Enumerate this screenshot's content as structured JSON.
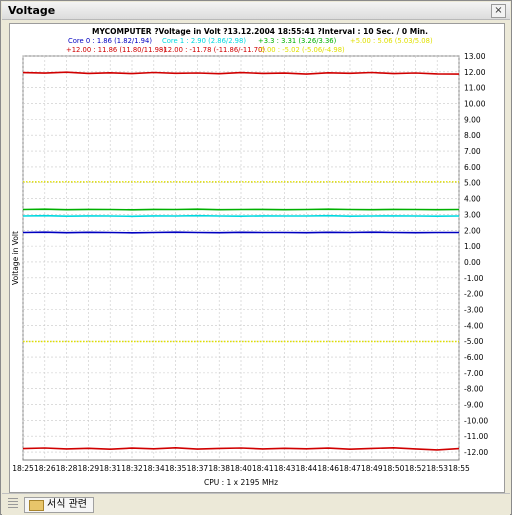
{
  "window": {
    "title": "Voltage",
    "close_glyph": "×"
  },
  "statusbar": {
    "tab_label": "서식 관련",
    "tab_icon": "folder-icon"
  },
  "colors": {
    "red": "#d00000",
    "blue": "#0000c0",
    "cyan": "#00d8e0",
    "green": "#00b000",
    "yellow": "#e0e000",
    "grid": "#c8c8c8"
  },
  "chart_data": {
    "type": "line",
    "title": "MYCOMPUTER ?Voltage in Volt ?13.12.2004 18:55:41 ?Interval : 10 Sec. / 0 Min.",
    "ylabel": "Voltage in Volt",
    "xlabel": "CPU : 1 x 2195 MHz",
    "ylim": [
      -12.5,
      13
    ],
    "y_ticks": [
      "13.00",
      "12.00",
      "11.00",
      "10.00",
      "9.00",
      "8.00",
      "7.00",
      "6.00",
      "5.00",
      "4.00",
      "3.00",
      "2.00",
      "1.00",
      "0.00",
      "-1.00",
      "-2.00",
      "-3.00",
      "-4.00",
      "-5.00",
      "-6.00",
      "-7.00",
      "-8.00",
      "-9.00",
      "-10.00",
      "-11.00",
      "-12.00"
    ],
    "x_ticks": [
      "18:25",
      "18:26",
      "18:28",
      "18:29",
      "18:31",
      "18:32",
      "18:34",
      "18:35",
      "18:37",
      "18:38",
      "18:40",
      "18:41",
      "18:43",
      "18:44",
      "18:46",
      "18:47",
      "18:49",
      "18:50",
      "18:52",
      "18:53",
      "18:55"
    ],
    "grid": true,
    "legend_position": "top",
    "legend": [
      {
        "text": "Core 0 : 1.86 (1.82/1.94)",
        "color": "#0000c0"
      },
      {
        "text": "Core 1 : 2.90 (2.86/2.98)",
        "color": "#00d8e0"
      },
      {
        "text": "+3.3 : 3.31 (3.26/3.36)",
        "color": "#00b000"
      },
      {
        "text": "+5.00 : 5.06 (5.03/5.08)",
        "color": "#e0e000"
      },
      {
        "text": "+12.00 : 11.86 (11.80/11.98)",
        "color": "#d00000"
      },
      {
        "text": "-12.00 : -11.78 (-11.86/-11.70)",
        "color": "#d00000"
      },
      {
        "text": "-5.00 : -5.02 (-5.06/-4.98)",
        "color": "#e0e000"
      }
    ],
    "series": [
      {
        "name": "Core 0",
        "color": "#0000c0",
        "values": [
          1.86,
          1.88,
          1.85,
          1.87,
          1.86,
          1.84,
          1.86,
          1.88,
          1.86,
          1.85,
          1.87,
          1.86,
          1.86,
          1.85,
          1.87,
          1.86,
          1.88,
          1.86,
          1.85,
          1.86,
          1.86
        ]
      },
      {
        "name": "Core 1",
        "color": "#00d8e0",
        "values": [
          2.9,
          2.92,
          2.89,
          2.91,
          2.9,
          2.88,
          2.91,
          2.9,
          2.92,
          2.9,
          2.89,
          2.91,
          2.9,
          2.9,
          2.92,
          2.89,
          2.9,
          2.91,
          2.9,
          2.89,
          2.9
        ]
      },
      {
        "name": "+3.3",
        "color": "#00b000",
        "values": [
          3.31,
          3.33,
          3.3,
          3.32,
          3.31,
          3.29,
          3.32,
          3.31,
          3.33,
          3.3,
          3.31,
          3.32,
          3.3,
          3.31,
          3.33,
          3.31,
          3.3,
          3.32,
          3.31,
          3.3,
          3.31
        ]
      },
      {
        "name": "+5.00",
        "color": "#e0e000",
        "values": [
          5.06,
          5.06,
          5.06,
          5.06,
          5.06,
          5.06,
          5.06,
          5.06,
          5.06,
          5.06,
          5.06,
          5.06,
          5.06,
          5.06,
          5.06,
          5.06,
          5.06,
          5.06,
          5.06,
          5.06,
          5.06
        ]
      },
      {
        "name": "+12.00",
        "color": "#d00000",
        "values": [
          11.95,
          11.92,
          11.98,
          11.9,
          11.94,
          11.89,
          11.96,
          11.91,
          11.93,
          11.88,
          11.95,
          11.9,
          11.92,
          11.86,
          11.94,
          11.91,
          11.96,
          11.89,
          11.93,
          11.87,
          11.86
        ]
      },
      {
        "name": "-12.00",
        "color": "#d00000",
        "values": [
          -11.78,
          -11.74,
          -11.8,
          -11.76,
          -11.82,
          -11.75,
          -11.79,
          -11.73,
          -11.81,
          -11.77,
          -11.74,
          -11.8,
          -11.76,
          -11.79,
          -11.75,
          -11.82,
          -11.77,
          -11.73,
          -11.8,
          -11.86,
          -11.78
        ]
      },
      {
        "name": "-5.00",
        "color": "#e0e000",
        "values": [
          -5.02,
          -5.02,
          -5.02,
          -5.02,
          -5.02,
          -5.02,
          -5.02,
          -5.02,
          -5.02,
          -5.02,
          -5.02,
          -5.02,
          -5.02,
          -5.02,
          -5.02,
          -5.02,
          -5.02,
          -5.02,
          -5.02,
          -5.02,
          -5.02
        ]
      }
    ]
  }
}
